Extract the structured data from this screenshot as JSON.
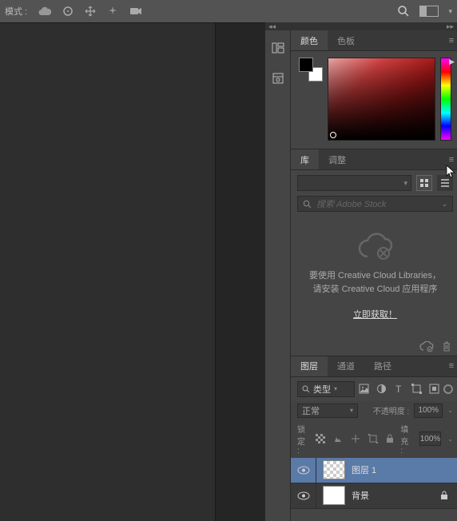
{
  "topbar": {
    "mode_label": "模式 :"
  },
  "panels": {
    "color": {
      "tab_color": "颜色",
      "tab_swatches": "色板"
    },
    "library": {
      "tab_lib": "库",
      "tab_adjust": "调整",
      "search_placeholder": "搜索 Adobe Stock",
      "msg_line1": "要使用 Creative Cloud Libraries，",
      "msg_line2": "请安装 Creative Cloud 应用程序",
      "link": "立即获取！"
    },
    "layers": {
      "tab_layers": "图层",
      "tab_channels": "通道",
      "tab_paths": "路径",
      "type_label": "类型",
      "blend_mode": "正常",
      "opacity_label": "不透明度 :",
      "opacity_value": "100%",
      "lock_label": "锁定 :",
      "fill_label": "填充 :",
      "fill_value": "100%",
      "rows": [
        {
          "name": "图层 1",
          "transparent": true,
          "selected": true,
          "locked": false
        },
        {
          "name": "背景",
          "transparent": false,
          "selected": false,
          "locked": true
        }
      ]
    }
  }
}
